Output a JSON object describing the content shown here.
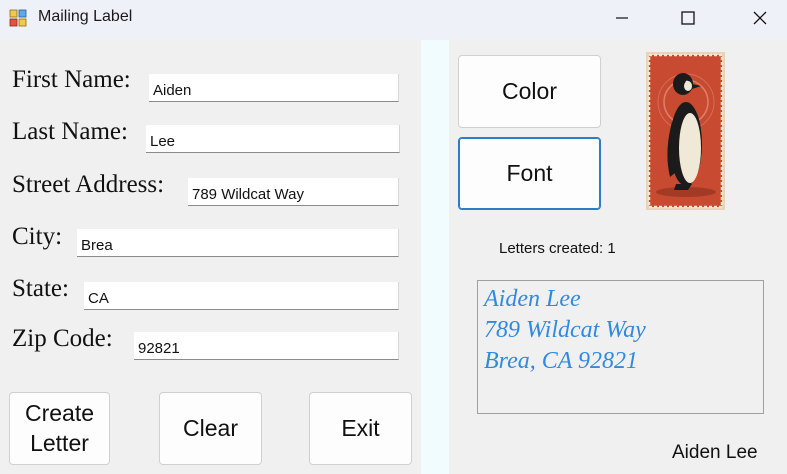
{
  "window": {
    "title": "Mailing Label",
    "minimize_icon": "minimize-icon",
    "maximize_icon": "maximize-icon",
    "close_icon": "close-icon"
  },
  "form": {
    "first_name": {
      "label": "First Name:",
      "value": "Aiden"
    },
    "last_name": {
      "label": "Last Name:",
      "value": "Lee"
    },
    "street": {
      "label": "Street Address:",
      "value": "789 Wildcat Way"
    },
    "city": {
      "label": "City:",
      "value": "Brea"
    },
    "state": {
      "label": "State:",
      "value": "CA"
    },
    "zip": {
      "label": "Zip Code:",
      "value": "92821"
    }
  },
  "buttons": {
    "create_letter_line1": "Create",
    "create_letter_line2": "Letter",
    "clear": "Clear",
    "exit": "Exit",
    "color": "Color",
    "font": "Font"
  },
  "stamp": {
    "icon": "penguin-stamp-image"
  },
  "status": {
    "letters_created": "Letters created: 1"
  },
  "label_preview": {
    "line1": "Aiden Lee",
    "line2": "789 Wildcat Way",
    "line3": "Brea, CA 92821",
    "color": "#2f8ae0"
  },
  "footer": {
    "name": "Aiden Lee"
  }
}
